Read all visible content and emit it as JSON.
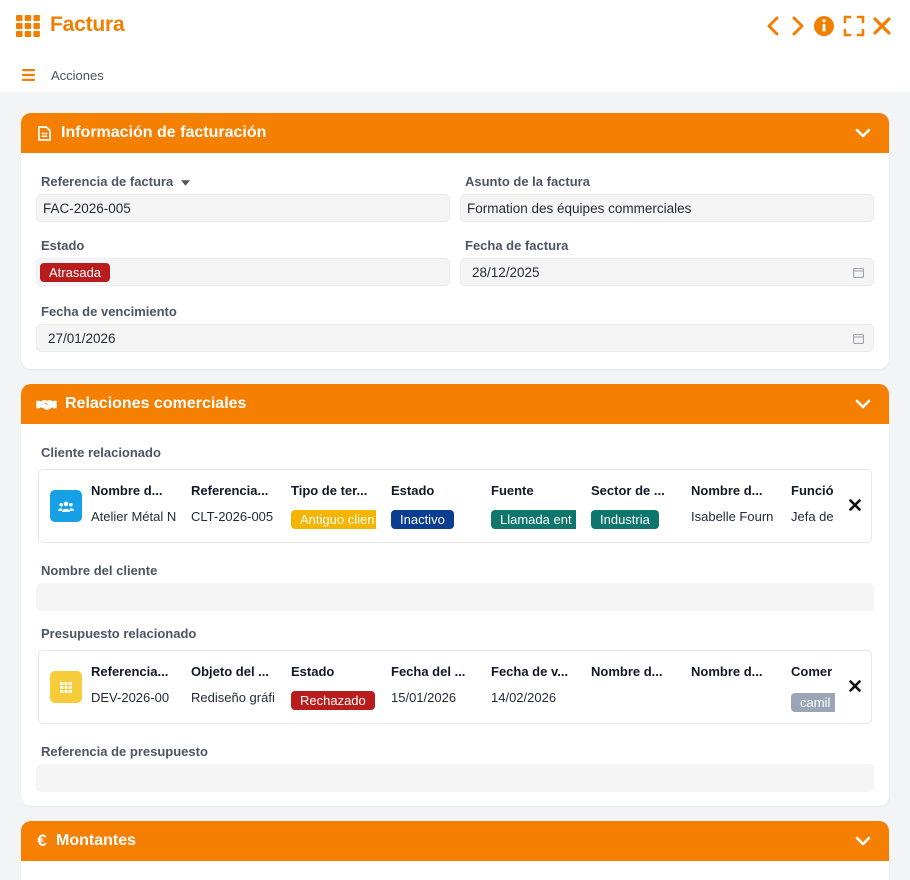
{
  "window": {
    "title": "Factura",
    "actions_label": "Acciones"
  },
  "colors": {
    "accent": "#f57f00",
    "status_overdue": "#b91c1c",
    "status_inactive": "#0b3d91",
    "tag_teal": "#0f766e",
    "tag_yellow": "#f5b400",
    "status_rejected": "#b91c1c",
    "tag_gray": "#9aa6b5"
  },
  "billing": {
    "header": "Información de facturación",
    "reference_label": "Referencia de factura",
    "reference_value": "FAC-2026-005",
    "subject_label": "Asunto de la factura",
    "subject_value": "Formation des équipes commerciales",
    "status_label": "Estado",
    "status_value": "Atrasada",
    "date_label": "Fecha de factura",
    "date_value": "28/12/2025",
    "due_label": "Fecha de vencimiento",
    "due_value": "27/01/2026"
  },
  "relations": {
    "header": "Relaciones comerciales",
    "client_section_label": "Cliente relacionado",
    "client_icon": "users-icon",
    "client": {
      "headers": [
        "Nombre d...",
        "Referencia...",
        "Tipo de ter...",
        "Estado",
        "Fuente",
        "Sector de ...",
        "Nombre d...",
        "Funció"
      ],
      "values": [
        "Atelier Métal N",
        "CLT-2026-005",
        "Antiguo clien",
        "Inactivo",
        "Llamada ent",
        "Industria",
        "Isabelle Fourn",
        "Jefa de"
      ]
    },
    "client_name_label": "Nombre del cliente",
    "client_name_value": "",
    "quote_section_label": "Presupuesto relacionado",
    "quote_icon": "grid-icon",
    "quote": {
      "headers": [
        "Referencia...",
        "Objeto del ...",
        "Estado",
        "Fecha del ...",
        "Fecha de v...",
        "Nombre d...",
        "Nombre d...",
        "Comer"
      ],
      "values": [
        "DEV-2026-00",
        "Rediseño gráfi",
        "Rechazado",
        "15/01/2026",
        "14/02/2026",
        "",
        "",
        "camil"
      ]
    },
    "quote_ref_label": "Referencia de presupuesto",
    "quote_ref_value": ""
  },
  "amounts": {
    "header": "Montantes",
    "icon": "euro-icon"
  }
}
